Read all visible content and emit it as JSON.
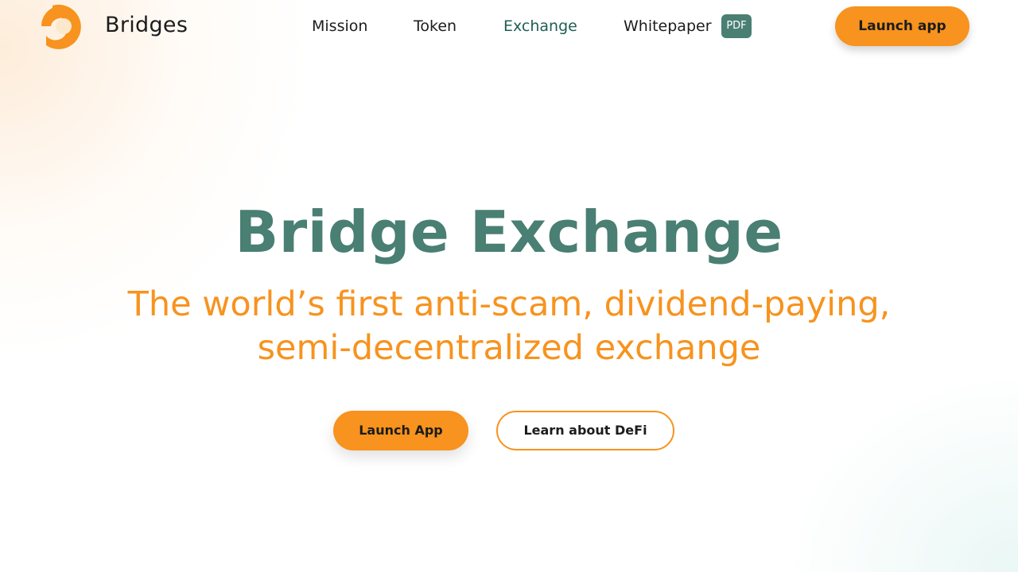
{
  "header": {
    "brand": "Bridges",
    "logo_icon": "bridges-logo-icon",
    "nav": {
      "mission": "Mission",
      "token": "Token",
      "exchange": "Exchange",
      "whitepaper": "Whitepaper",
      "pdf_badge": "PDF"
    },
    "active_nav": "Exchange",
    "launch_button": "Launch app"
  },
  "hero": {
    "title": "Bridge Exchange",
    "subtitle_line1": "The world’s first anti-scam, dividend-paying,",
    "subtitle_line2": "semi-decentralized exchange",
    "primary_button": "Launch App",
    "secondary_button": "Learn about DeFi"
  },
  "colors": {
    "accent_orange": "#f7931e",
    "brand_teal": "#4a7f73",
    "active_nav_teal": "#1f5e54",
    "text_dark": "#1c1c1c"
  }
}
